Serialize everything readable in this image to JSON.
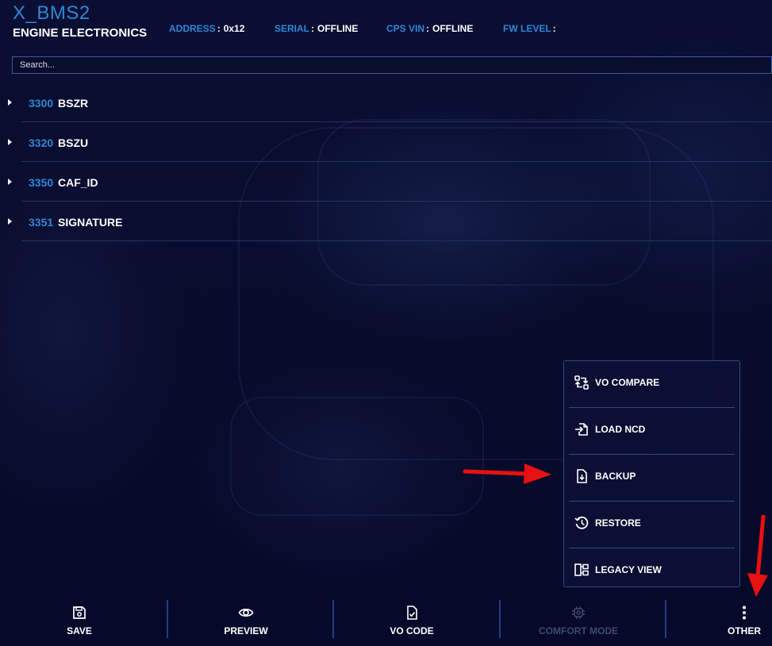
{
  "header": {
    "title": "X_BMS2",
    "subtitle": "ENGINE ELECTRONICS",
    "info": [
      {
        "label": "ADDRESS",
        "value": "0x12"
      },
      {
        "label": "SERIAL",
        "value": "OFFLINE"
      },
      {
        "label": "CPS VIN",
        "value": "OFFLINE"
      },
      {
        "label": "FW LEVEL",
        "value": ""
      }
    ],
    "separator": ":"
  },
  "search": {
    "placeholder": "Search...",
    "value": ""
  },
  "tree": [
    {
      "code": "3300",
      "name": "BSZR"
    },
    {
      "code": "3320",
      "name": "BSZU"
    },
    {
      "code": "3350",
      "name": "CAF_ID"
    },
    {
      "code": "3351",
      "name": "SIGNATURE"
    }
  ],
  "menu": {
    "items": [
      {
        "label": "VO COMPARE",
        "icon": "compare-arrows-icon"
      },
      {
        "label": "LOAD NCD",
        "icon": "file-import-icon"
      },
      {
        "label": "BACKUP",
        "icon": "file-download-icon"
      },
      {
        "label": "RESTORE",
        "icon": "history-icon"
      },
      {
        "label": "LEGACY VIEW",
        "icon": "folder-tree-icon"
      }
    ]
  },
  "bottom_bar": {
    "buttons": [
      {
        "label": "SAVE",
        "icon": "floppy-disk-icon",
        "enabled": true
      },
      {
        "label": "PREVIEW",
        "icon": "eye-icon",
        "enabled": true
      },
      {
        "label": "VO CODE",
        "icon": "file-check-icon",
        "enabled": true
      },
      {
        "label": "COMFORT MODE",
        "icon": "chip-icon",
        "enabled": false
      },
      {
        "label": "OTHER",
        "icon": "more-vertical-icon",
        "enabled": true
      }
    ]
  },
  "colors": {
    "accent": "#2f86d6",
    "background": "#070b2a",
    "divider": "#1e3568",
    "disabled": "#3c4a6c",
    "annotation_arrow": "#e81010"
  }
}
